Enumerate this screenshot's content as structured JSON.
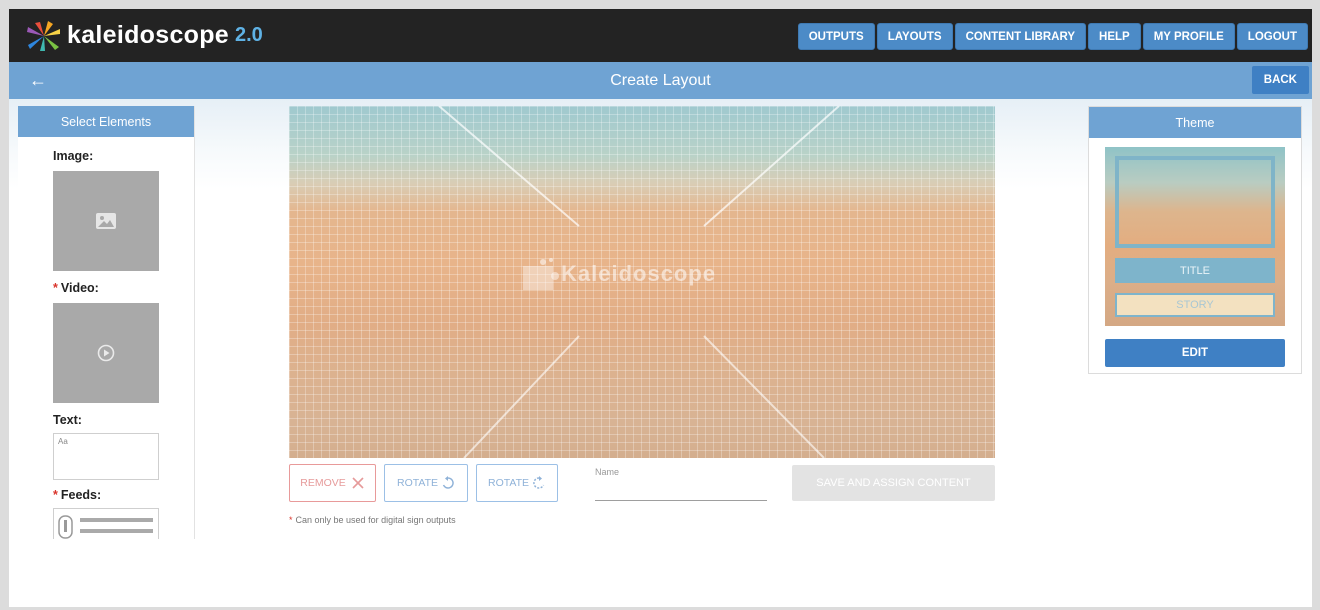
{
  "app": {
    "name": "kaleidoscope",
    "version": "2.0"
  },
  "nav": {
    "items": [
      {
        "label": "OUTPUTS"
      },
      {
        "label": "LAYOUTS"
      },
      {
        "label": "CONTENT LIBRARY"
      },
      {
        "label": "HELP"
      },
      {
        "label": "MY PROFILE"
      },
      {
        "label": "LOGOUT"
      }
    ]
  },
  "subheader": {
    "back_arrow": "←",
    "title": "Create Layout",
    "back_label": "BACK"
  },
  "elements_panel": {
    "title": "Select Elements",
    "image_label": "Image:",
    "video_label": "Video:",
    "text_label": "Text:",
    "text_placeholder": "Aa",
    "feeds_label": "Feeds:",
    "required_mark": "*",
    "icons": {
      "image": "image-icon",
      "video": "play-icon",
      "feeds": "feed-list-icon"
    }
  },
  "canvas": {
    "watermark": "Kaleidoscope",
    "background": "beach-sand-photo"
  },
  "actions": {
    "remove_label": "REMOVE",
    "rotate_left_label": "ROTATE",
    "rotate_right_label": "ROTATE",
    "name_label": "Name",
    "name_value": "",
    "save_label": "SAVE AND ASSIGN CONTENT",
    "note_mark": "*",
    "note_text": "Can only be used for digital sign outputs"
  },
  "theme_panel": {
    "title": "Theme",
    "preview_title": "TITLE",
    "preview_story": "STORY",
    "edit_label": "EDIT"
  },
  "colors": {
    "topbar": "#232323",
    "accent_blue": "#4c8bc7",
    "header_blue": "#6fa3d3",
    "version_blue": "#5fb2e5",
    "required_red": "#d9342b"
  }
}
